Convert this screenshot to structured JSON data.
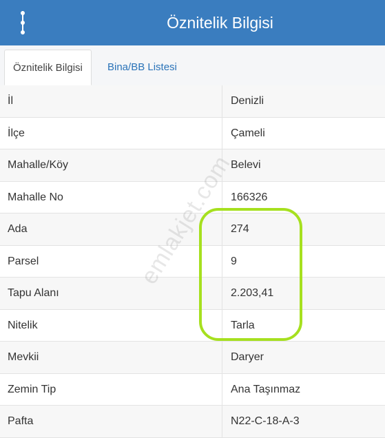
{
  "header": {
    "title": "Öznitelik Bilgisi",
    "menu_icon": "vertical-dots-icon",
    "color": "#3a7dbf"
  },
  "tabs": [
    {
      "label": "Öznitelik Bilgisi",
      "active": true
    },
    {
      "label": "Bina/BB Listesi",
      "active": false
    }
  ],
  "rows": [
    {
      "label": "İl",
      "value": "Denizli"
    },
    {
      "label": "İlçe",
      "value": "Çameli"
    },
    {
      "label": "Mahalle/Köy",
      "value": "Belevi"
    },
    {
      "label": "Mahalle No",
      "value": "166326"
    },
    {
      "label": "Ada",
      "value": "274"
    },
    {
      "label": "Parsel",
      "value": "9"
    },
    {
      "label": "Tapu Alanı",
      "value": "2.203,41"
    },
    {
      "label": "Nitelik",
      "value": "Tarla"
    },
    {
      "label": "Mevkii",
      "value": "Daryer"
    },
    {
      "label": "Zemin Tip",
      "value": "Ana Taşınmaz"
    },
    {
      "label": "Pafta",
      "value": "N22-C-18-A-3"
    }
  ],
  "watermark": "emlakjet.com",
  "highlight_color": "#a6e01f"
}
